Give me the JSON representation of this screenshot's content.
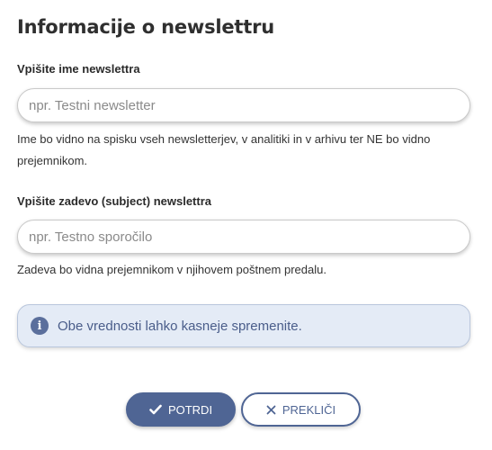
{
  "title": "Informacije o newslettru",
  "name_field": {
    "label": "Vpišite ime newslettra",
    "placeholder": "npr. Testni newsletter",
    "value": "",
    "help": "Ime bo vidno na spisku vseh newsletterjev, v analitiki in v arhivu ter NE bo vidno prejemnikom."
  },
  "subject_field": {
    "label": "Vpišite zadevo (subject) newslettra",
    "placeholder": "npr. Testno sporočilo",
    "value": "",
    "help": "Zadeva bo vidna prejemnikom v njihovem poštnem predalu."
  },
  "info": {
    "icon": "info-icon",
    "text": "Obe vrednosti lahko kasneje spremenite."
  },
  "buttons": {
    "confirm_label": "POTRDI",
    "confirm_icon": "check-icon",
    "cancel_label": "PREKLIČI",
    "cancel_icon": "close-icon"
  },
  "colors": {
    "primary": "#4f6594",
    "info_background": "#e4ebf6",
    "info_text": "#4a5d8a"
  }
}
